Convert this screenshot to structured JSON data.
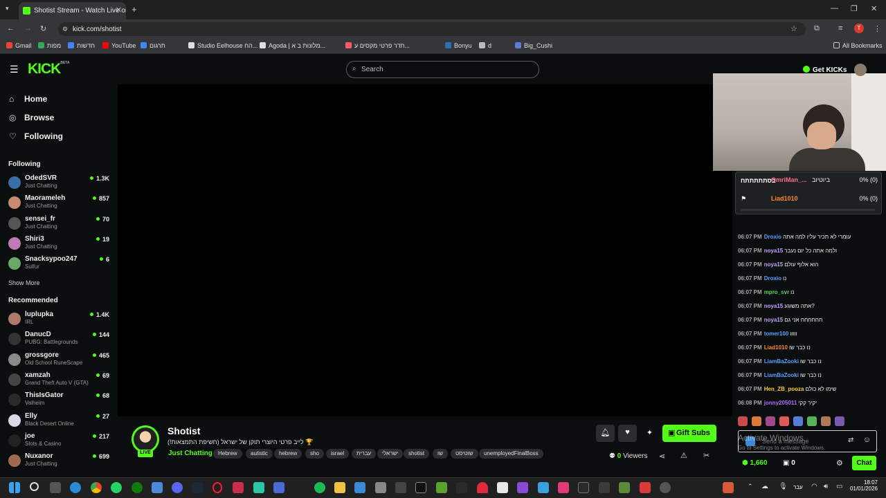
{
  "browser": {
    "tab_title": "Shotist Stream - Watch Live on",
    "url": "kick.com/shotist",
    "avatar_letter": "T",
    "bookmarks": [
      "Gmail",
      "מפות",
      "YouTube",
      "חדשות",
      "תרגום",
      "Studio Eelhouse הח...",
      "Agoda | מלונות ב א...",
      "חדר פרטי מקסים ע...",
      "Bonyu",
      "d",
      "Big_Cushi"
    ],
    "all_bookmarks": "All Bookmarks"
  },
  "header": {
    "logo": "KICK",
    "logo_badge": "BETA",
    "search_placeholder": "Search",
    "get_kicks": "Get KICKs"
  },
  "sidebar": {
    "nav": [
      {
        "label": "Home",
        "icon": "home-icon"
      },
      {
        "label": "Browse",
        "icon": "compass-icon"
      },
      {
        "label": "Following",
        "icon": "heart-icon"
      }
    ],
    "following_heading": "Following",
    "following": [
      {
        "name": "OdedSVR",
        "category": "Just Chatting",
        "viewers": "1.3K",
        "color": "#3b6ea8"
      },
      {
        "name": "Maorameleh",
        "category": "Just Chatting",
        "viewers": "857",
        "color": "#c98a70"
      },
      {
        "name": "sensei_fr",
        "category": "Just Chatting",
        "viewers": "70",
        "color": "#555555"
      },
      {
        "name": "Shiri3",
        "category": "Just Chatting",
        "viewers": "19",
        "color": "#c47ab5"
      },
      {
        "name": "Snacksypoo247",
        "category": "Sulfur",
        "viewers": "6",
        "color": "#6aa86a"
      }
    ],
    "show_more": "Show More",
    "recommended_heading": "Recommended",
    "recommended": [
      {
        "name": "luplupka",
        "category": "IRL",
        "viewers": "1.4K",
        "color": "#b07a6a"
      },
      {
        "name": "DanucD",
        "category": "PUBG: Battlegrounds",
        "viewers": "144",
        "color": "#333333"
      },
      {
        "name": "grossgore",
        "category": "Old School RuneScape",
        "viewers": "465",
        "color": "#8a8a8a"
      },
      {
        "name": "xamzah",
        "category": "Grand Theft Auto V (GTA)",
        "viewers": "69",
        "color": "#444444"
      },
      {
        "name": "ThisIsGator",
        "category": "Valheim",
        "viewers": "68",
        "color": "#2a2a2a"
      },
      {
        "name": "Elly",
        "category": "Black Desert Online",
        "viewers": "27",
        "color": "#d8d8e8"
      },
      {
        "name": "joe",
        "category": "Slots & Casino",
        "viewers": "217",
        "color": "#222222"
      },
      {
        "name": "Nuxanor",
        "category": "Just Chatting",
        "viewers": "699",
        "color": "#a06a50"
      }
    ]
  },
  "stream": {
    "name": "Shotist",
    "live_label": "LIVE",
    "title": "לייב פרטי היוצרי תוקן של ישראל (חשיפת התמצאות!) 🏆",
    "category": "Just Chatting",
    "tags": [
      "Hebrew",
      "autistic",
      "hebrew",
      "sho",
      "israel",
      "עברית",
      "ישראלי",
      "shotist",
      "שו",
      "שוטיסט",
      "unemployedFinalBoss"
    ],
    "gift_subs": "Gift Subs",
    "viewers_count": "0",
    "viewers_label": "Viewers"
  },
  "chat": {
    "polls": [
      {
        "name": "OmriMan_...",
        "text": "ביוטיוב",
        "pct": "0% (0)"
      },
      {
        "name": "Liad1010",
        "text": "",
        "pct": "0% (0)"
      }
    ],
    "poll_label": "בסתתתתתח",
    "poll_fill": 0,
    "messages": [
      {
        "time": "06:07 PM",
        "user": "Droxio",
        "color": "#5aa0ff",
        "text": "עומרי לא תכיר עליו למה אתה"
      },
      {
        "time": "06:07 PM",
        "user": "noya15",
        "color": "#c8a0ff",
        "text": "ולמה אתה כל יום נעבר"
      },
      {
        "time": "06:07 PM",
        "user": "noya15",
        "color": "#c8a0ff",
        "text": "הוא אלוף עולם"
      },
      {
        "time": "06:07 PM",
        "user": "Droxio",
        "color": "#5aa0ff",
        "text": "נו"
      },
      {
        "time": "06:07 PM",
        "user": "mpro_svr",
        "color": "#5fd35f",
        "text": "נו"
      },
      {
        "time": "06:07 PM",
        "user": "noya15",
        "color": "#c8a0ff",
        "text": "אתה משוגע?"
      },
      {
        "time": "06:07 PM",
        "user": "noya15",
        "color": "#c8a0ff",
        "text": "חחחחחח אני גם"
      },
      {
        "time": "06:07 PM",
        "user": "tomer100",
        "color": "#5aa0ff",
        "text": "ווווו"
      },
      {
        "time": "06:07 PM",
        "user": "Liad1010",
        "color": "#ff8a2a",
        "text": "נו כבר שו"
      },
      {
        "time": "06:07 PM",
        "user": "LiamBaZooki",
        "color": "#5aa0ff",
        "text": "נו כבר שו"
      },
      {
        "time": "06:07 PM",
        "user": "LiamBaZooki",
        "color": "#5aa0ff",
        "text": "נו כבר שו"
      },
      {
        "time": "06:07 PM",
        "user": "Hen_ZB_pooza",
        "color": "#ffcc33",
        "text": "שימו לא כולם"
      },
      {
        "time": "06:08 PM",
        "user": "jonny205011",
        "color": "#b86aff",
        "text": "יקיר קקי"
      }
    ],
    "input_placeholder": "Send a message",
    "watermark_title": "Activate Windows",
    "watermark_sub": "Go to Settings to activate Windows.",
    "kick_points": "1,660",
    "gift_count": "0",
    "chat_button": "Chat"
  },
  "taskbar": {
    "time": "18:07",
    "date": "01/01/2026",
    "lang": "עבר"
  }
}
